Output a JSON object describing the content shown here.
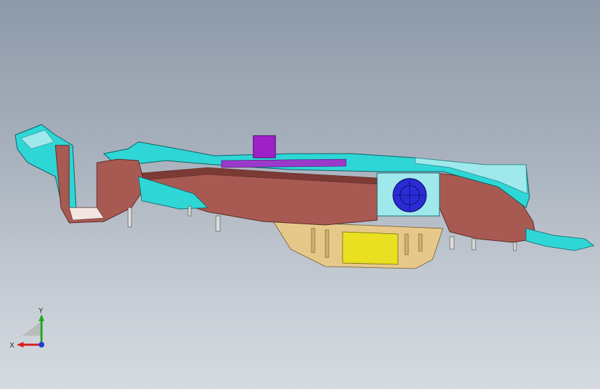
{
  "viewport": {
    "background_top": "#8e9aa9",
    "background_bottom": "#d6dbe1"
  },
  "model": {
    "part_colors": {
      "cyan_shell": "#2fd6d6",
      "cyan_light": "#9fe9ec",
      "brown_body": "#a85a52",
      "brown_dark": "#7c3a35",
      "purple_clip": "#a020c8",
      "yellow_block": "#e8e020",
      "tan_housing": "#e6c98a",
      "blue_fan": "#2b2bd6"
    }
  },
  "triad": {
    "x_label": "X",
    "y_label": "Y",
    "x_color": "#d81e1e",
    "y_color": "#1ea81e",
    "z_color": "#1e3ad8"
  }
}
